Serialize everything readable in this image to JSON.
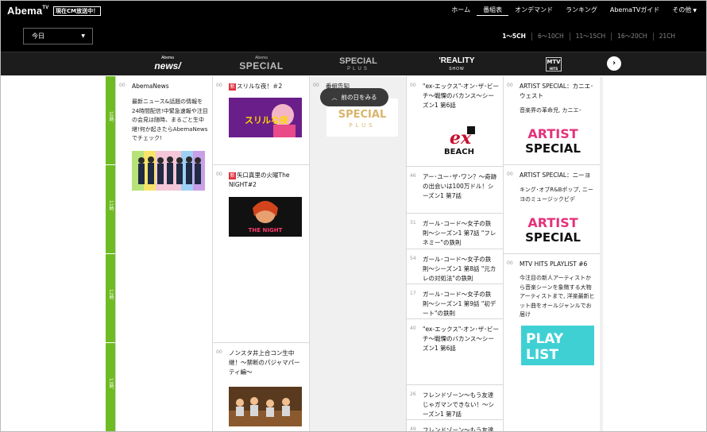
{
  "app": {
    "logo": "Abema",
    "logo_sup": "TV",
    "live_badge": "現在CM放送中！"
  },
  "nav": {
    "items": [
      {
        "label": "ホーム",
        "active": false
      },
      {
        "label": "番組表",
        "active": true
      },
      {
        "label": "オンデマンド",
        "active": false
      },
      {
        "label": "ランキング",
        "active": false
      },
      {
        "label": "AbemaTVガイド",
        "active": false
      },
      {
        "label": "その他",
        "active": false
      }
    ]
  },
  "date_select": {
    "value": "今日"
  },
  "channel_ranges": [
    "1〜5CH",
    "6〜10CH",
    "11〜15CH",
    "16〜20CH",
    "21CH"
  ],
  "channels": {
    "news": {
      "top": "Abema",
      "main": "news/"
    },
    "special": {
      "top": "Abema",
      "main": "SPECIAL"
    },
    "plus": {
      "top": "SPECIAL",
      "bottom": "PLUS"
    },
    "reality": {
      "main": "'REALITY",
      "sub": "SHOW"
    },
    "mtv": {
      "main": "MTV",
      "sub": "HITS"
    }
  },
  "hours": [
    "10時",
    "11時",
    "12時",
    "13時"
  ],
  "prev_day_button": "前の日をみる",
  "columns": {
    "news": [
      {
        "min": "00",
        "title": "AbemaNews",
        "desc": "最新ニュース&話題の情報を24時間配信!中緊急速報や注目の会見は随時、まるごと生中継!何か起きたらAbemaNewsでチェック!"
      }
    ],
    "special": [
      {
        "min": "00",
        "new": "新",
        "title": "スリルな夜！＃2"
      },
      {
        "min": "00",
        "new": "新",
        "title": "矢口真里の火曜The NIGHT#2"
      },
      {
        "min": "00",
        "title": "ノンスタ井上合コン生中継！〜禁断のパジャマパーティ編〜"
      }
    ],
    "plus": [
      {
        "min": "00",
        "title": "番組告知",
        "logo_top": "SPECIAL",
        "logo_bottom": "PLUS"
      }
    ],
    "reality": [
      {
        "min": "00",
        "title": "\"ex-エックス\"-オン･ザ･ビーチ〜戦慄のバカンス〜シーズン1 第6話"
      },
      {
        "min": "46",
        "title": "アー･ユー･ザ･ワン？〜奇跡の出会いは100万ドル！シーズン1 第7話"
      },
      {
        "min": "31",
        "title": "ガール･コード〜女子の鉄則〜シーズン1 第7話 \"フレネミー\"の鉄則"
      },
      {
        "min": "54",
        "title": "ガール･コード〜女子の鉄則〜シーズン1 第8話 \"元カレの対処法\"の鉄則"
      },
      {
        "min": "17",
        "title": "ガール･コード〜女子の鉄則〜シーズン1 第9話 \"初デート\"の鉄則"
      },
      {
        "min": "40",
        "title": "\"ex-エックス\"-オン･ザ･ビーチ〜戦慄のバカンス〜シーズン1 第6話"
      },
      {
        "min": "26",
        "title": "フレンドゾーン〜もう友達じゃガマンできない！〜シーズン1 第7話"
      },
      {
        "min": "49",
        "title": "フレンドゾーン〜もう友達"
      }
    ],
    "mtv": [
      {
        "min": "00",
        "title": "ARTIST SPECIAL：カニエ･ウェスト",
        "desc": "音楽界の革命児, カニエ･",
        "thumb_line1": "ARTIST",
        "thumb_line2": "SPECIAL"
      },
      {
        "min": "00",
        "title": "ARTIST SPECIAL：ニーヨ",
        "desc": "キング･オブR&Bポップ, ニーヨのミュージックビデ",
        "thumb_line1": "ARTIST",
        "thumb_line2": "SPECIAL"
      },
      {
        "min": "00",
        "title": "MTV HITS PLAYLIST #6",
        "desc": "今注目の新人アーティストから音楽シーンを象徴する大物アーティストまで, 洋楽最新ヒット曲をオールジャンルでお届け",
        "thumb_line1": "PLAY",
        "thumb_line2": "LIST"
      }
    ]
  },
  "thumbs": {
    "ex_beach_line1": "ex",
    "ex_beach_line2": "BEACH",
    "thrill_caption": "スリルな夜",
    "night_caption": "THE NIGHT"
  },
  "colors": {
    "time_green": "#6fbb22",
    "new_badge": "#e0313f",
    "artist_pink": "#e4317b",
    "playlist_cyan": "#3fd0d4"
  }
}
